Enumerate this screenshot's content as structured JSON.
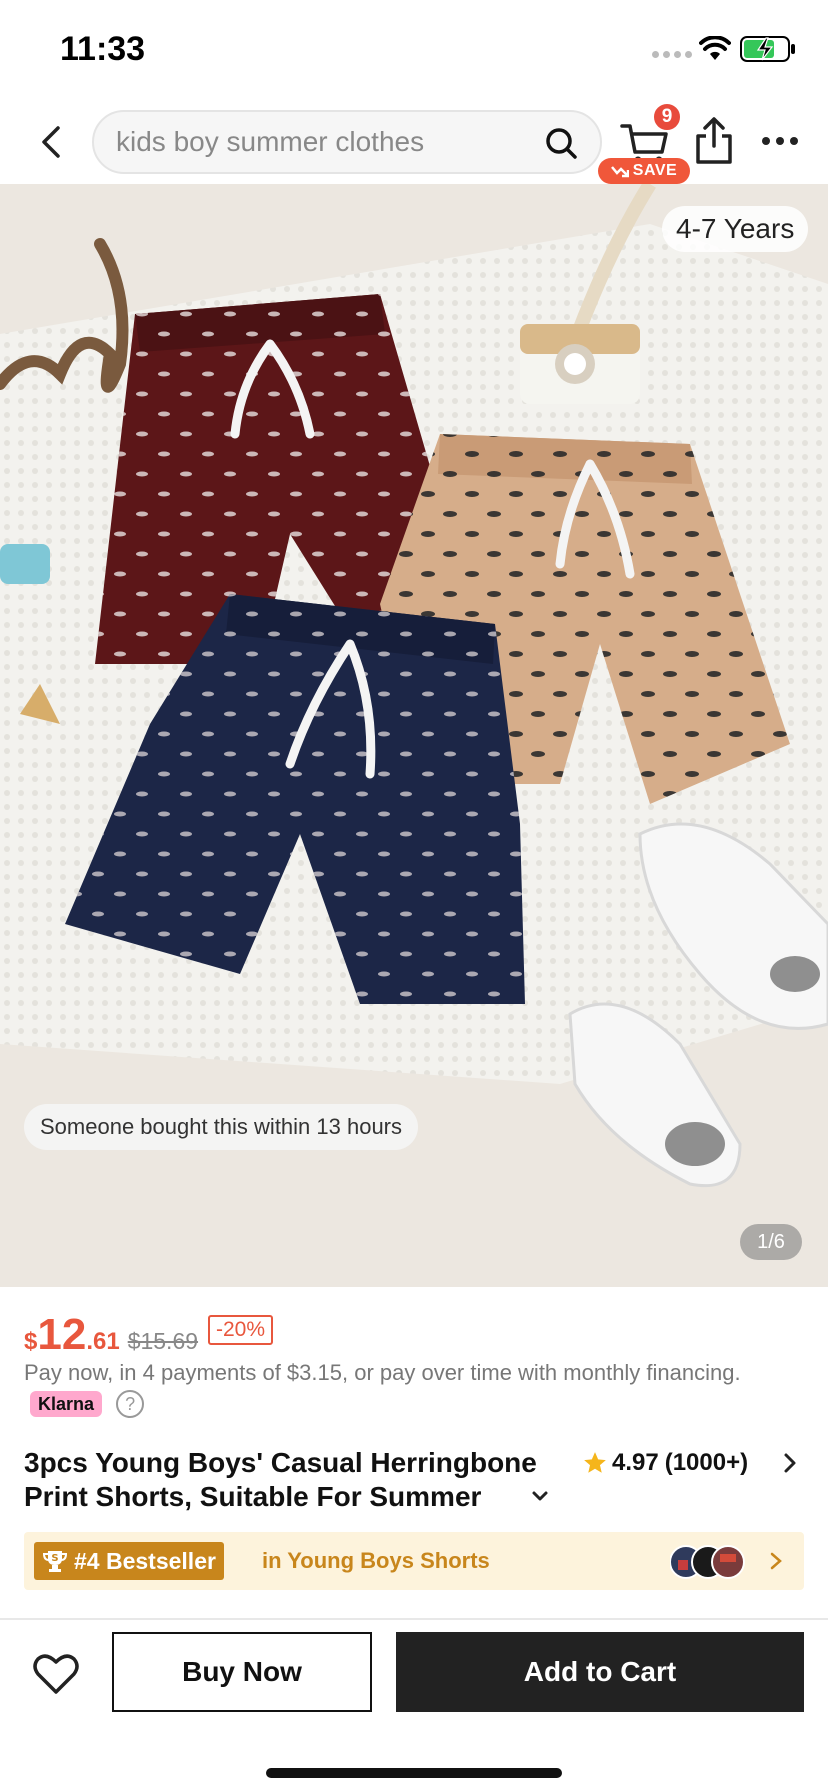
{
  "status_bar": {
    "time": "11:33"
  },
  "header": {
    "search_placeholder": "kids boy summer clothes",
    "cart_count": "9",
    "save_label": "SAVE"
  },
  "gallery": {
    "age_tag": "4-7 Years",
    "social_proof": "Someone bought this within 13 hours",
    "page_indicator": "1/6"
  },
  "price": {
    "currency": "$",
    "integer": "12",
    "decimal": ".61",
    "original": "$15.69",
    "discount": "-20%"
  },
  "payment": {
    "text": "Pay now, in 4 payments of $3.15, or pay over time with monthly financing.",
    "klarna_label": "Klarna",
    "help_label": "?"
  },
  "product": {
    "title": "3pcs Young Boys' Casual Herringbone Print Shorts, Suitable For Summer",
    "rating": "4.97",
    "rating_count": "(1000+)"
  },
  "bestseller": {
    "badge": "#4 Bestseller",
    "category": "in Young Boys Shorts"
  },
  "actions": {
    "buy_now": "Buy Now",
    "add_to_cart": "Add to Cart"
  },
  "colors": {
    "accent": "#e8573d",
    "bestseller_gold": "#c8861c",
    "bestseller_bg": "#fdf3dc",
    "cta_dark": "#222222"
  }
}
